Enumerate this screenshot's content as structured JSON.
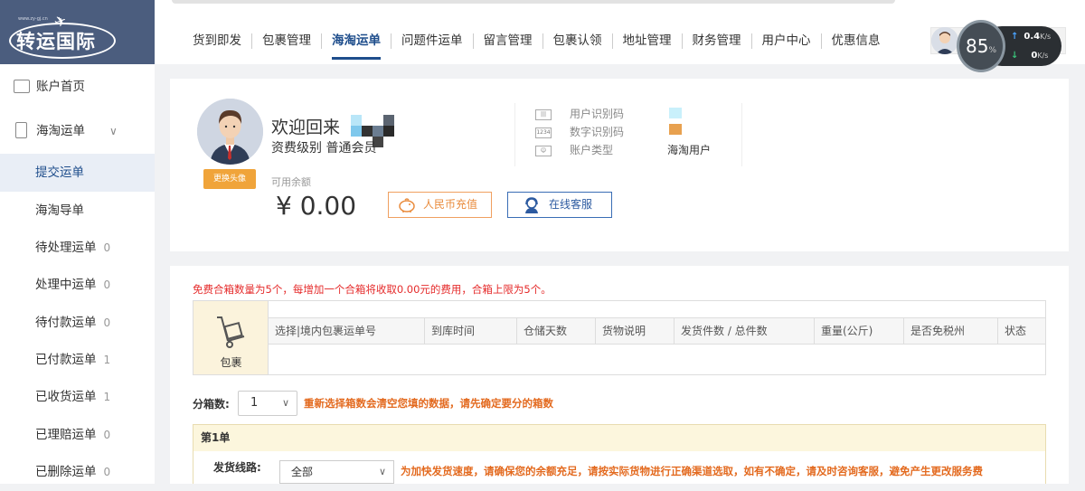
{
  "logo": {
    "text": "转运国际",
    "small": "www.zy-gj.cn"
  },
  "nav": {
    "items": [
      "货到即发",
      "包裹管理",
      "海淘运单",
      "问题件运单",
      "留言管理",
      "包裹认领",
      "地址管理",
      "财务管理",
      "用户中心",
      "优惠信息"
    ],
    "active_index": 2
  },
  "speed_widget": {
    "percent": "85",
    "percent_unit": "%",
    "up": "0.4",
    "down": "0",
    "unit": "K/s",
    "up_arrow": "↑",
    "down_arrow": "↓"
  },
  "sidebar": {
    "account_home": "账户首页",
    "haitao_orders": "海淘运单",
    "items": [
      {
        "label": "提交运单",
        "count": ""
      },
      {
        "label": "海淘导单",
        "count": ""
      },
      {
        "label": "待处理运单",
        "count": "0"
      },
      {
        "label": "处理中运单",
        "count": "0"
      },
      {
        "label": "待付款运单",
        "count": "0"
      },
      {
        "label": "已付款运单",
        "count": "1"
      },
      {
        "label": "已收货运单",
        "count": "1"
      },
      {
        "label": "已理赔运单",
        "count": "0"
      },
      {
        "label": "已删除运单",
        "count": "0"
      }
    ],
    "active_index": 0
  },
  "profile": {
    "welcome": "欢迎回来",
    "level_label": "资费级别",
    "level_value": "普通会员",
    "change_avatar": "更换头像",
    "balance_label": "可用余额",
    "balance": "¥ 0.00",
    "recharge_button": "人民币充值",
    "service_button": "在线客服",
    "info": [
      {
        "icon": "barcode-icon",
        "label": "用户识别码",
        "value": ""
      },
      {
        "icon": "number-code-icon",
        "label": "数字识别码",
        "value": ""
      },
      {
        "icon": "account-type-icon",
        "label": "账户类型",
        "value": "海淘用户"
      }
    ]
  },
  "order": {
    "notice": "免费合箱数量为5个，每增加一个合箱将收取0.00元的费用，合箱上限为5个。",
    "package_label": "包裹",
    "columns": [
      "选择|境内包裹运单号",
      "到库时间",
      "仓储天数",
      "货物说明",
      "发货件数 / 总件数",
      "重量(公斤)",
      "是否免税州",
      "状态"
    ],
    "split_label": "分箱数:",
    "split_value": "1",
    "split_warning": "重新选择箱数会清空您填的数据，请先确定要分的箱数",
    "box_title": "第1单",
    "route_label": "发货线路:",
    "route_value": "全部",
    "route_warning": "为加快发货速度，请确保您的余额充足，请按实际货物进行正确渠道选取，如有不确定，请及时咨询客服，避免产生更改服务费"
  },
  "colors": {
    "primary": "#1f4e8c",
    "logo_bg": "#4b5d7e",
    "accent": "#f0a43a",
    "warning": "#e36a1f",
    "notice": "#e52b2b"
  }
}
